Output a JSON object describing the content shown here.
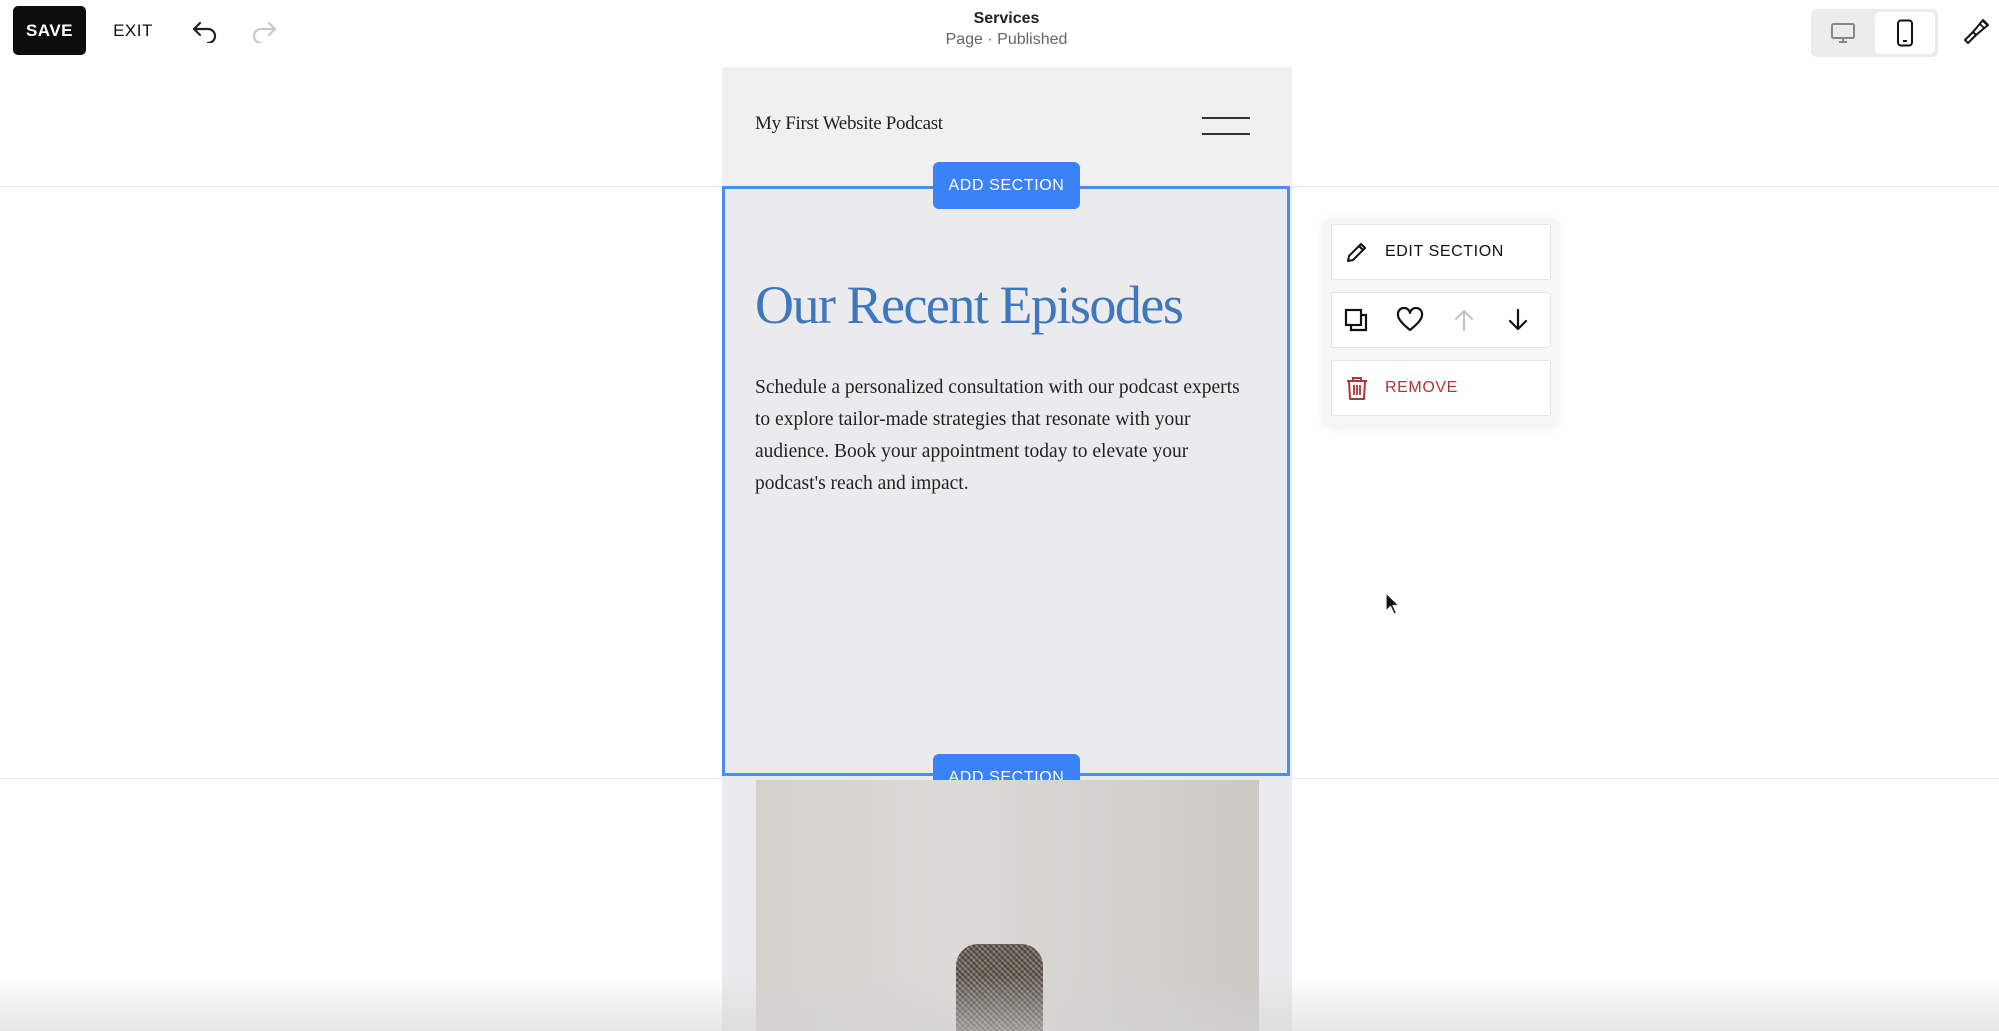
{
  "toolbar": {
    "save_label": "SAVE",
    "exit_label": "EXIT",
    "page_title": "Services",
    "page_status": "Page · Published"
  },
  "site": {
    "title": "My First Website Podcast"
  },
  "section": {
    "add_section_label": "ADD SECTION",
    "heading": "Our Recent Episodes",
    "body": "Schedule a personalized consultation with our podcast experts to explore tailor-made strategies that resonate with your audience. Book your appointment today to elevate your podcast's reach and impact."
  },
  "section_menu": {
    "edit_label": "EDIT SECTION",
    "remove_label": "REMOVE"
  },
  "icons": [
    "undo-icon",
    "redo-icon",
    "desktop-icon",
    "mobile-icon",
    "paintbrush-icon",
    "hamburger-menu-icon",
    "pencil-icon",
    "duplicate-icon",
    "heart-icon",
    "arrow-up-icon",
    "arrow-down-icon",
    "trash-icon",
    "cursor-icon"
  ],
  "colors": {
    "accent_blue": "#3b82f6",
    "heading_blue": "#3e77c0",
    "remove_red": "#b0343a",
    "save_bg": "#0d0d0d"
  }
}
